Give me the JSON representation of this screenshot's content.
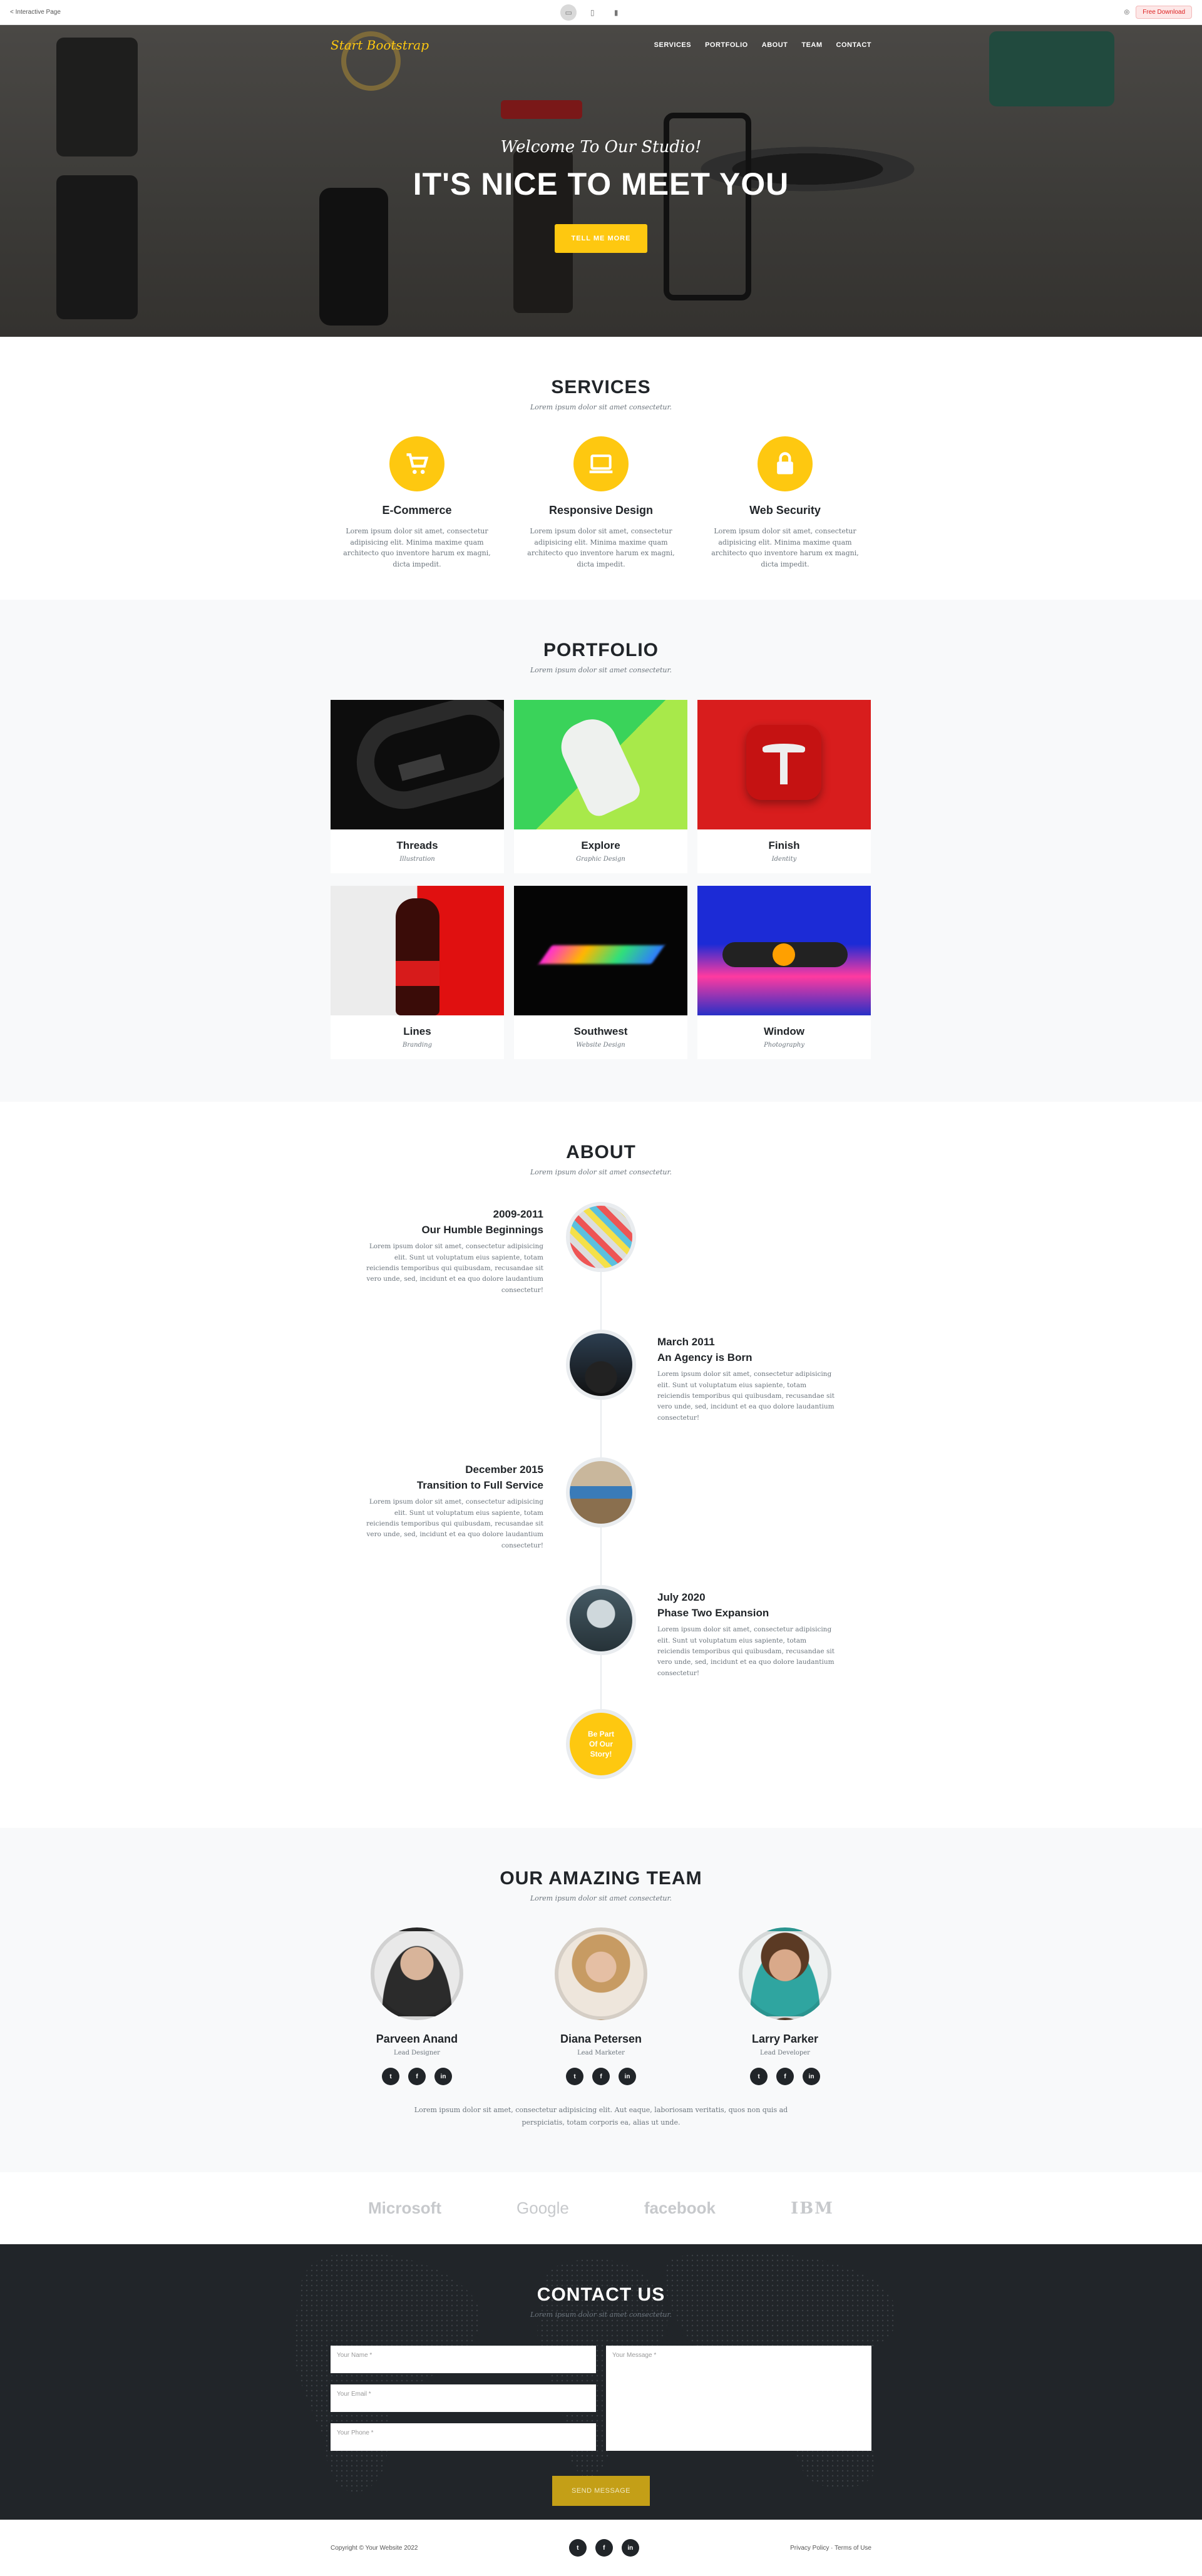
{
  "topbar": {
    "back_label": "< Interactive Page",
    "free_download": "Free Download"
  },
  "nav": {
    "brand": "Start Bootstrap",
    "items": [
      "SERVICES",
      "PORTFOLIO",
      "ABOUT",
      "TEAM",
      "CONTACT"
    ]
  },
  "hero": {
    "subtitle": "Welcome To Our Studio!",
    "title": "IT'S NICE TO MEET YOU",
    "button": "TELL ME MORE"
  },
  "services": {
    "title": "SERVICES",
    "subtitle": "Lorem ipsum dolor sit amet consectetur.",
    "items": [
      {
        "title": "E-Commerce",
        "text": "Lorem ipsum dolor sit amet, consectetur adipisicing elit. Minima maxime quam architecto quo inventore harum ex magni, dicta impedit."
      },
      {
        "title": "Responsive Design",
        "text": "Lorem ipsum dolor sit amet, consectetur adipisicing elit. Minima maxime quam architecto quo inventore harum ex magni, dicta impedit."
      },
      {
        "title": "Web Security",
        "text": "Lorem ipsum dolor sit amet, consectetur adipisicing elit. Minima maxime quam architecto quo inventore harum ex magni, dicta impedit."
      }
    ]
  },
  "portfolio": {
    "title": "PORTFOLIO",
    "subtitle": "Lorem ipsum dolor sit amet consectetur.",
    "items": [
      {
        "title": "Threads",
        "category": "Illustration"
      },
      {
        "title": "Explore",
        "category": "Graphic Design"
      },
      {
        "title": "Finish",
        "category": "Identity"
      },
      {
        "title": "Lines",
        "category": "Branding"
      },
      {
        "title": "Southwest",
        "category": "Website Design"
      },
      {
        "title": "Window",
        "category": "Photography"
      }
    ]
  },
  "about": {
    "title": "ABOUT",
    "subtitle": "Lorem ipsum dolor sit amet consectetur.",
    "events": [
      {
        "date": "2009-2011",
        "heading": "Our Humble Beginnings",
        "text": "Lorem ipsum dolor sit amet, consectetur adipisicing elit. Sunt ut voluptatum eius sapiente, totam reiciendis temporibus qui quibusdam, recusandae sit vero unde, sed, incidunt et ea quo dolore laudantium consectetur!"
      },
      {
        "date": "March 2011",
        "heading": "An Agency is Born",
        "text": "Lorem ipsum dolor sit amet, consectetur adipisicing elit. Sunt ut voluptatum eius sapiente, totam reiciendis temporibus qui quibusdam, recusandae sit vero unde, sed, incidunt et ea quo dolore laudantium consectetur!"
      },
      {
        "date": "December 2015",
        "heading": "Transition to Full Service",
        "text": "Lorem ipsum dolor sit amet, consectetur adipisicing elit. Sunt ut voluptatum eius sapiente, totam reiciendis temporibus qui quibusdam, recusandae sit vero unde, sed, incidunt et ea quo dolore laudantium consectetur!"
      },
      {
        "date": "July 2020",
        "heading": "Phase Two Expansion",
        "text": "Lorem ipsum dolor sit amet, consectetur adipisicing elit. Sunt ut voluptatum eius sapiente, totam reiciendis temporibus qui quibusdam, recusandae sit vero unde, sed, incidunt et ea quo dolore laudantium consectetur!"
      }
    ],
    "end_1": "Be Part",
    "end_2": "Of Our",
    "end_3": "Story!"
  },
  "team": {
    "title": "OUR AMAZING TEAM",
    "subtitle": "Lorem ipsum dolor sit amet consectetur.",
    "members": [
      {
        "name": "Parveen Anand",
        "role": "Lead Designer"
      },
      {
        "name": "Diana Petersen",
        "role": "Lead Marketer"
      },
      {
        "name": "Larry Parker",
        "role": "Lead Developer"
      }
    ],
    "note": "Lorem ipsum dolor sit amet, consectetur adipisicing elit. Aut eaque, laboriosam veritatis, quos non quis ad perspiciatis, totam corporis ea, alias ut unde."
  },
  "clients": [
    "Microsoft",
    "Google",
    "facebook",
    "IBM"
  ],
  "contact": {
    "title": "CONTACT US",
    "subtitle": "Lorem ipsum dolor sit amet consectetur.",
    "name_placeholder": "Your Name *",
    "email_placeholder": "Your Email *",
    "phone_placeholder": "Your Phone *",
    "message_placeholder": "Your Message *",
    "send": "SEND MESSAGE"
  },
  "footer": {
    "copyright": "Copyright © Your Website 2022",
    "privacy": "Privacy Policy",
    "terms": "Terms of Use"
  },
  "colors": {
    "accent": "#fec810",
    "dark": "#212529"
  }
}
